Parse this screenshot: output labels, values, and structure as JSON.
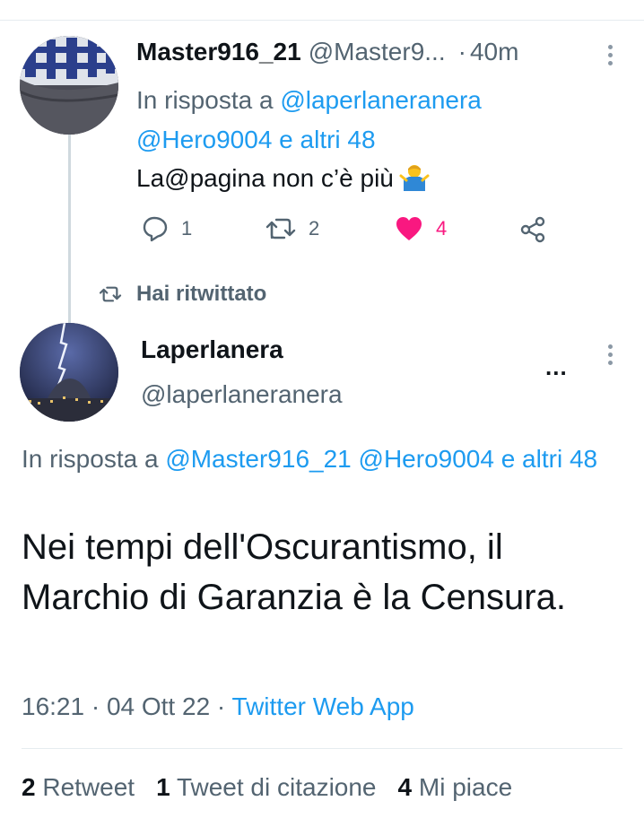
{
  "reply": {
    "display_name": "Master916_21",
    "handle": "@Master9...",
    "dot": "·",
    "time": "40m",
    "in_reply_prefix": "In risposta a",
    "in_reply_mention1": "@laperlaneranera",
    "in_reply_mention2": "@Hero9004 e altri 48",
    "text": "La@pagina non c’è più",
    "emoji_icon": "man-shrugging-icon",
    "reply_count": "1",
    "retweet_count": "2",
    "like_count": "4",
    "like_color": "#f91880"
  },
  "retweet_banner": {
    "label": "Hai ritwittato"
  },
  "main": {
    "display_name": "Laperlanera",
    "handle": "@laperlaneranera",
    "more": "...",
    "in_reply_prefix": "In risposta a",
    "in_reply_mentions": "@Master916_21 @Hero9004 e altri 48",
    "text": "Nei tempi dell'Oscurantismo, il Marchio di Garanzia è la Censura.",
    "timestamp": "16:21 · 04 Ott 22 · ",
    "source": "Twitter Web App"
  },
  "stats": {
    "retweets_count": "2",
    "retweets_label": "Retweet",
    "quotes_count": "1",
    "quotes_label": "Tweet di citazione",
    "likes_count": "4",
    "likes_label": "Mi piace"
  },
  "colors": {
    "link": "#1d9bf0",
    "secondary_text": "#536471"
  }
}
